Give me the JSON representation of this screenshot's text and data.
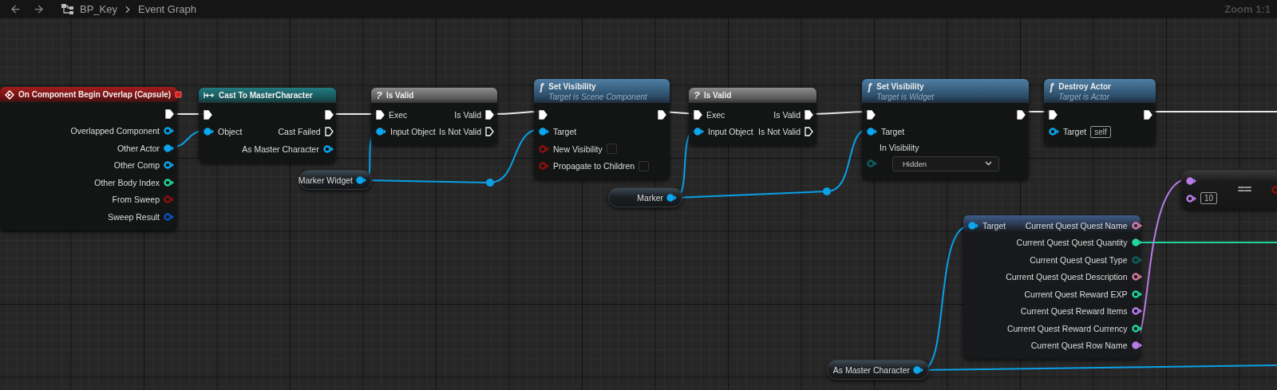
{
  "toolbar": {
    "breadcrumb": [
      "BP_Key",
      "Event Graph"
    ],
    "zoom": "Zoom 1:1"
  },
  "nodes": [
    {
      "kind": "event",
      "title": "On Component Begin Overlap (Capsule)",
      "outputs": [
        {
          "kind": "exec",
          "connected": true
        },
        {
          "label": "Overlapped Component",
          "kind": "data",
          "color": "#0aa6ef",
          "connected": false
        },
        {
          "label": "Other Actor",
          "kind": "data",
          "color": "#0aa6ef",
          "connected": true
        },
        {
          "label": "Other Comp",
          "kind": "data",
          "color": "#0aa6ef",
          "connected": false
        },
        {
          "label": "Other Body Index",
          "kind": "data",
          "color": "#1fd69f",
          "connected": false
        },
        {
          "label": "From Sweep",
          "kind": "data",
          "color": "#8c0f0f",
          "connected": false
        },
        {
          "label": "Sweep Result",
          "kind": "data",
          "color": "#0a50c0",
          "connected": false
        }
      ]
    },
    {
      "kind": "cast",
      "title": "Cast To MasterCharacter",
      "inputs": [
        {
          "kind": "exec",
          "connected": true
        },
        {
          "label": "Object",
          "kind": "data",
          "color": "#0aa6ef",
          "connected": true
        }
      ],
      "outputs": [
        {
          "kind": "exec",
          "connected": true
        },
        {
          "label": "Cast Failed",
          "kind": "exec",
          "connected": false
        },
        {
          "label": "As Master Character",
          "kind": "data",
          "color": "#0aa6ef",
          "connected": false
        }
      ]
    },
    {
      "kind": "macro",
      "glyph": "?",
      "title": "Is Valid",
      "inputs": [
        {
          "label": "Exec",
          "kind": "exec",
          "connected": true
        },
        {
          "label": "Input Object",
          "kind": "data",
          "color": "#0aa6ef",
          "connected": true
        }
      ],
      "outputs": [
        {
          "label": "Is Valid",
          "kind": "exec",
          "connected": true
        },
        {
          "label": "Is Not Valid",
          "kind": "exec",
          "connected": false
        }
      ]
    },
    {
      "kind": "variable",
      "title": "Marker Widget",
      "outputs": [
        {
          "kind": "data",
          "color": "#0aa6ef",
          "connected": true
        }
      ]
    },
    {
      "kind": "function",
      "glyph": "ƒ",
      "title": "Set Visibility",
      "subtitle": "Target is Scene Component",
      "inputs": [
        {
          "kind": "exec",
          "connected": true
        },
        {
          "label": "Target",
          "kind": "data",
          "color": "#0aa6ef",
          "connected": true
        },
        {
          "label": "New Visibility",
          "kind": "checkbox",
          "color": "#8c0f0f",
          "connected": false,
          "checked": false
        },
        {
          "label": "Propagate to Children",
          "kind": "checkbox",
          "color": "#8c0f0f",
          "connected": false,
          "checked": false
        }
      ],
      "outputs": [
        {
          "kind": "exec",
          "connected": true
        }
      ]
    },
    {
      "kind": "macro",
      "glyph": "?",
      "title": "Is Valid",
      "inputs": [
        {
          "label": "Exec",
          "kind": "exec",
          "connected": true
        },
        {
          "label": "Input Object",
          "kind": "data",
          "color": "#0aa6ef",
          "connected": true
        }
      ],
      "outputs": [
        {
          "label": "Is Valid",
          "kind": "exec",
          "connected": true
        },
        {
          "label": "Is Not Valid",
          "kind": "exec",
          "connected": false
        }
      ]
    },
    {
      "kind": "variable",
      "title": "Marker",
      "outputs": [
        {
          "kind": "data",
          "color": "#0aa6ef",
          "connected": true
        }
      ]
    },
    {
      "kind": "function",
      "glyph": "ƒ",
      "title": "Set Visibility",
      "subtitle": "Target is Widget",
      "inputs": [
        {
          "kind": "exec",
          "connected": true
        },
        {
          "label": "Target",
          "kind": "data",
          "color": "#0aa6ef",
          "connected": true
        },
        {
          "label": "In Visibility",
          "kind": "dropdown",
          "color": "#0b6160",
          "connected": false,
          "value": "Hidden"
        }
      ],
      "outputs": [
        {
          "kind": "exec",
          "connected": true
        }
      ]
    },
    {
      "kind": "function",
      "glyph": "ƒ",
      "title": "Destroy Actor",
      "subtitle": "Target is Actor",
      "inputs": [
        {
          "kind": "exec",
          "connected": true
        },
        {
          "label": "Target",
          "kind": "data",
          "color": "#0aa6ef",
          "connected": false,
          "value": "self"
        }
      ],
      "outputs": [
        {
          "kind": "exec",
          "connected": true
        }
      ]
    },
    {
      "kind": "compact",
      "title": "==",
      "inputs": [
        {
          "kind": "data",
          "color": "#b87ce8",
          "connected": true
        },
        {
          "kind": "data",
          "color": "#b87ce8",
          "connected": false,
          "value": "10"
        }
      ],
      "outputs": [
        {
          "kind": "data",
          "color": "#8c0f0f",
          "connected": false
        }
      ]
    },
    {
      "kind": "getter",
      "inputs": [
        {
          "label": "Target",
          "kind": "data",
          "color": "#0aa6ef",
          "connected": true
        }
      ],
      "outputs": [
        {
          "label": "Current Quest Quest Name",
          "kind": "data",
          "color": "#d8789e",
          "connected": false
        },
        {
          "label": "Current Quest Quest Quantity",
          "kind": "data",
          "color": "#1fd69f",
          "connected": true
        },
        {
          "label": "Current Quest Quest Type",
          "kind": "data",
          "color": "#0b6160",
          "connected": false
        },
        {
          "label": "Current Quest Quest Description",
          "kind": "data",
          "color": "#d8789e",
          "connected": false
        },
        {
          "label": "Current Quest Reward EXP",
          "kind": "data",
          "color": "#1fd69f",
          "connected": false
        },
        {
          "label": "Current Quest Reward Items",
          "kind": "data",
          "color": "#b87ce8",
          "connected": false
        },
        {
          "label": "Current Quest Reward Currency",
          "kind": "data",
          "color": "#1fd69f",
          "connected": false
        },
        {
          "label": "Current Quest Row Name",
          "kind": "data",
          "color": "#b87ce8",
          "connected": true
        }
      ]
    },
    {
      "kind": "variable",
      "title": "As Master Character",
      "outputs": [
        {
          "kind": "data",
          "color": "#0aa6ef",
          "connected": true
        }
      ]
    }
  ]
}
